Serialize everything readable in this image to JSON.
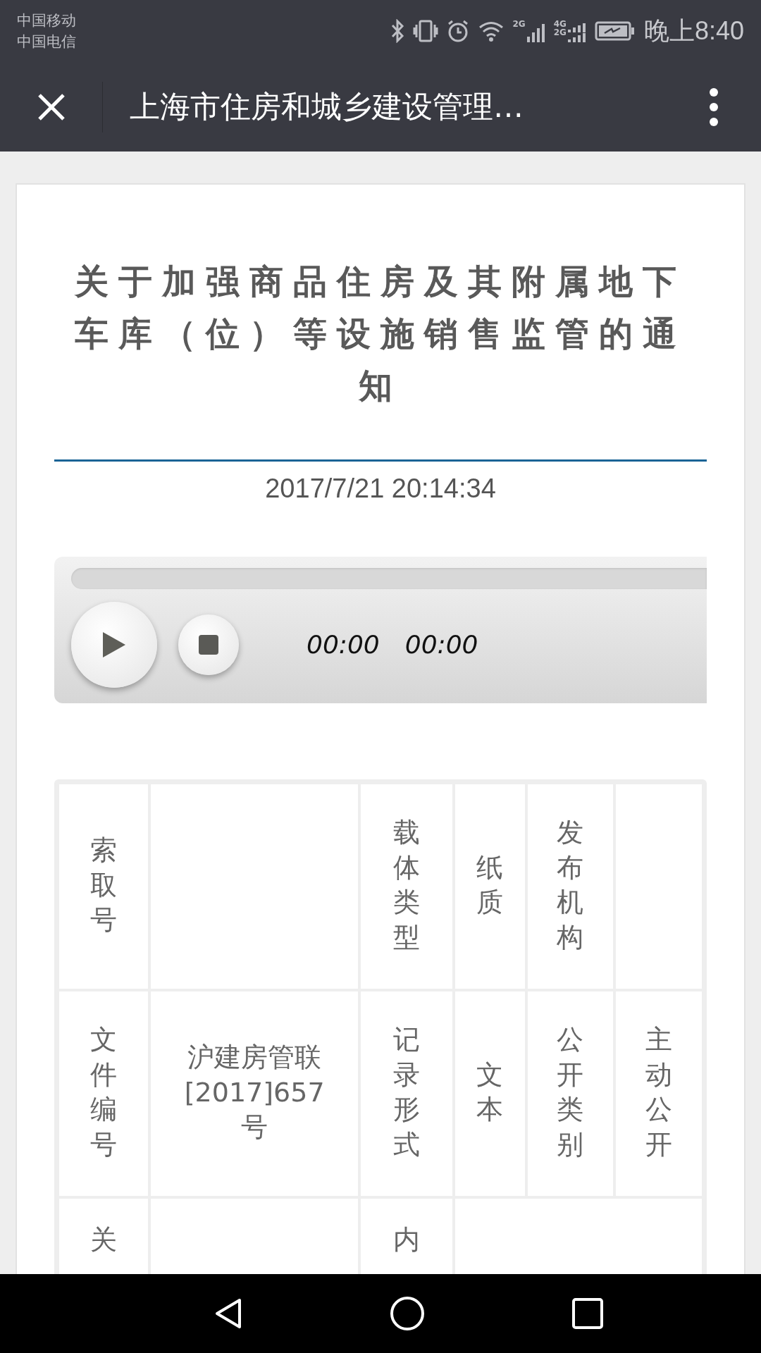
{
  "status_bar": {
    "carriers": [
      "中国移动",
      "中国电信"
    ],
    "signal_labels": [
      [
        "2G"
      ],
      [
        "4G",
        "2G"
      ]
    ],
    "time": "晚上8:40"
  },
  "toolbar": {
    "title": "上海市住房和城乡建设管理…"
  },
  "article": {
    "title": "关于加强商品住房及其附属地下车库（位）等设施销售监管的通知",
    "date": "2017/7/21 20:14:34"
  },
  "audio_player": {
    "current_time": "00:00",
    "duration": "00:00"
  },
  "table": {
    "rows": [
      [
        {
          "kind": "vertical",
          "text": "索取号"
        },
        {
          "kind": "empty"
        },
        {
          "kind": "vertical",
          "text": "载体类型"
        },
        {
          "kind": "vertical",
          "text": "纸质"
        },
        {
          "kind": "vertical",
          "text": "发布机构"
        },
        {
          "kind": "empty"
        }
      ],
      [
        {
          "kind": "vertical",
          "text": "文件编号"
        },
        {
          "kind": "horizontal",
          "text": "沪建房管联[2017]657号"
        },
        {
          "kind": "vertical",
          "text": "记录形式"
        },
        {
          "kind": "vertical",
          "text": "文本"
        },
        {
          "kind": "vertical",
          "text": "公开类别"
        },
        {
          "kind": "vertical",
          "text": "主动公开"
        }
      ],
      [
        {
          "kind": "vertical",
          "text": "关"
        },
        {
          "kind": "empty"
        },
        {
          "kind": "vertical",
          "text": "内"
        },
        {
          "kind": "wide_empty"
        }
      ]
    ]
  }
}
